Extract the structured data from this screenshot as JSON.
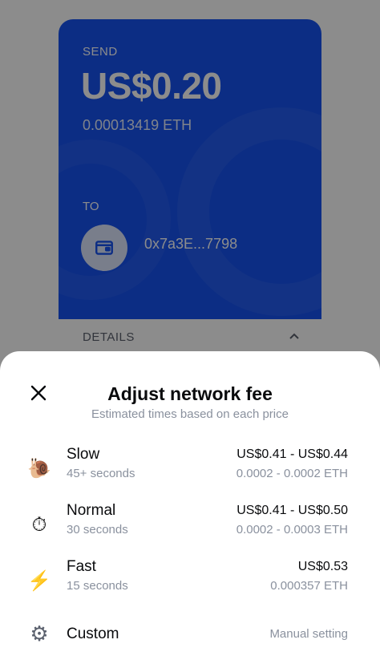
{
  "send_card": {
    "send_label": "SEND",
    "amount_usd": "US$0.20",
    "amount_eth": "0.00013419 ETH",
    "to_label": "TO",
    "to_address": "0x7a3E...7798",
    "details_label": "DETAILS"
  },
  "sheet": {
    "title": "Adjust network fee",
    "subtitle": "Estimated times based on each price",
    "options": [
      {
        "name": "Slow",
        "time": "45+ seconds",
        "usd": "US$0.41 - US$0.44",
        "eth": "0.0002 - 0.0002 ETH",
        "icon": "snail-icon",
        "glyph": "🐌"
      },
      {
        "name": "Normal",
        "time": "30 seconds",
        "usd": "US$0.41 - US$0.50",
        "eth": "0.0002 - 0.0003 ETH",
        "icon": "stopwatch-icon",
        "glyph": "⏱"
      },
      {
        "name": "Fast",
        "time": "15 seconds",
        "usd": "US$0.53",
        "eth": "0.000357 ETH",
        "icon": "lightning-icon",
        "glyph": "⚡"
      }
    ],
    "custom": {
      "name": "Custom",
      "setting": "Manual setting",
      "icon": "gear-icon",
      "glyph": "⚙"
    }
  },
  "colors": {
    "brand_blue": "#1652f0",
    "text_primary": "#0a0b0d",
    "text_secondary": "#8a919e"
  }
}
